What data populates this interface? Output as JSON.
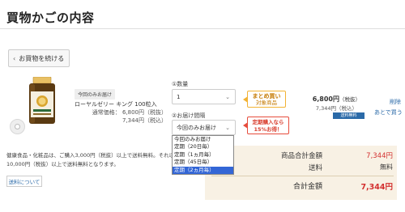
{
  "page": {
    "title": "買物かごの内容"
  },
  "nav": {
    "back_label": "お買物を続ける"
  },
  "item": {
    "badge": "今回のみお届け",
    "name": "ローヤルゼリー キング 100粒入",
    "normal_price": "通常価格： 6,800円（税抜）",
    "tax_price": "7,344円（税込）",
    "line_price": "6,800円",
    "line_price_note": "（税抜）",
    "line_tax": "7,344円（税込）",
    "shipping_badge": "送料無料",
    "delete_link": "削除",
    "later_link": "あとで買う"
  },
  "form": {
    "quantity_label": "①数量",
    "quantity_value": "1",
    "interval_label": "②お届け間隔",
    "interval_value": "今回のみお届け",
    "interval_options": [
      "今回のみお届け",
      "定期（20日毎）",
      "定期（1ヵ月毎）",
      "定期（45日毎）",
      "定期（2ヵ月毎）"
    ],
    "interval_highlighted_index": 4
  },
  "callouts": {
    "bulk_line1": "まとめ買い",
    "bulk_line2": "対象商品",
    "regular_line1": "定期購入なら",
    "regular_line2": "15%お得！"
  },
  "notes": {
    "line1": "健康食品・化粧品は、ご購入3,000円（税抜）以上で送料無料。それ以外の",
    "line2": "10,000円（税抜）以上で送料無料となります。",
    "about_button": "送料について"
  },
  "summary": {
    "subtotal_label": "商品合計金額",
    "subtotal_value": "7,344円",
    "shipping_label": "送料",
    "shipping_value": "無料",
    "total_label": "合計金額",
    "total_value": "7,344円"
  },
  "colors": {
    "accent_red": "#d32f2f",
    "link_blue": "#2b6aa8",
    "summary_bg": "#f8f1e4",
    "bulk_border": "#f2b233",
    "regular_border": "#e74c3c",
    "dropdown_highlight": "#3366d6"
  }
}
